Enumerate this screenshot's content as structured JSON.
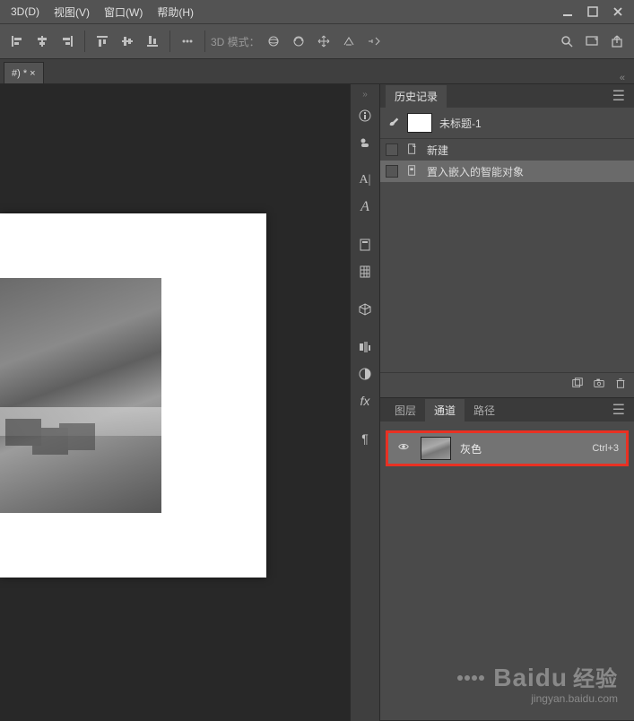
{
  "menubar": {
    "items": [
      "3D(D)",
      "视图(V)",
      "窗口(W)",
      "帮助(H)"
    ]
  },
  "optbar": {
    "mode_label": "3D 模式："
  },
  "tab": {
    "title": "#) * ×"
  },
  "history_panel": {
    "tab": "历史记录",
    "doc_title": "未标题-1",
    "items": [
      {
        "label": "新建"
      },
      {
        "label": "置入嵌入的智能对象"
      }
    ]
  },
  "channels_panel": {
    "tabs": [
      "图层",
      "通道",
      "路径"
    ],
    "active_tab": 1,
    "rows": [
      {
        "name": "灰色",
        "shortcut": "Ctrl+3"
      }
    ]
  },
  "watermark": {
    "brand": "Baidu",
    "brand_cn": "经验",
    "url": "jingyan.baidu.com"
  }
}
